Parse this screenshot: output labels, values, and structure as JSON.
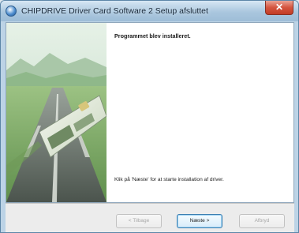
{
  "window": {
    "title": "CHIPDRIVE Driver Card Software 2 Setup afsluttet",
    "close_symbol": "✕"
  },
  "content": {
    "heading": "Programmet blev installeret.",
    "message": "Klik på 'Næste' for at starte installation af driver."
  },
  "buttons": {
    "back_label": "< Tilbage",
    "next_label": "Næste >",
    "cancel_label": "Afbryd"
  },
  "colors": {
    "accent": "#3c7fb1",
    "close": "#d4553f",
    "sidebar_green": "#7fae6a"
  }
}
